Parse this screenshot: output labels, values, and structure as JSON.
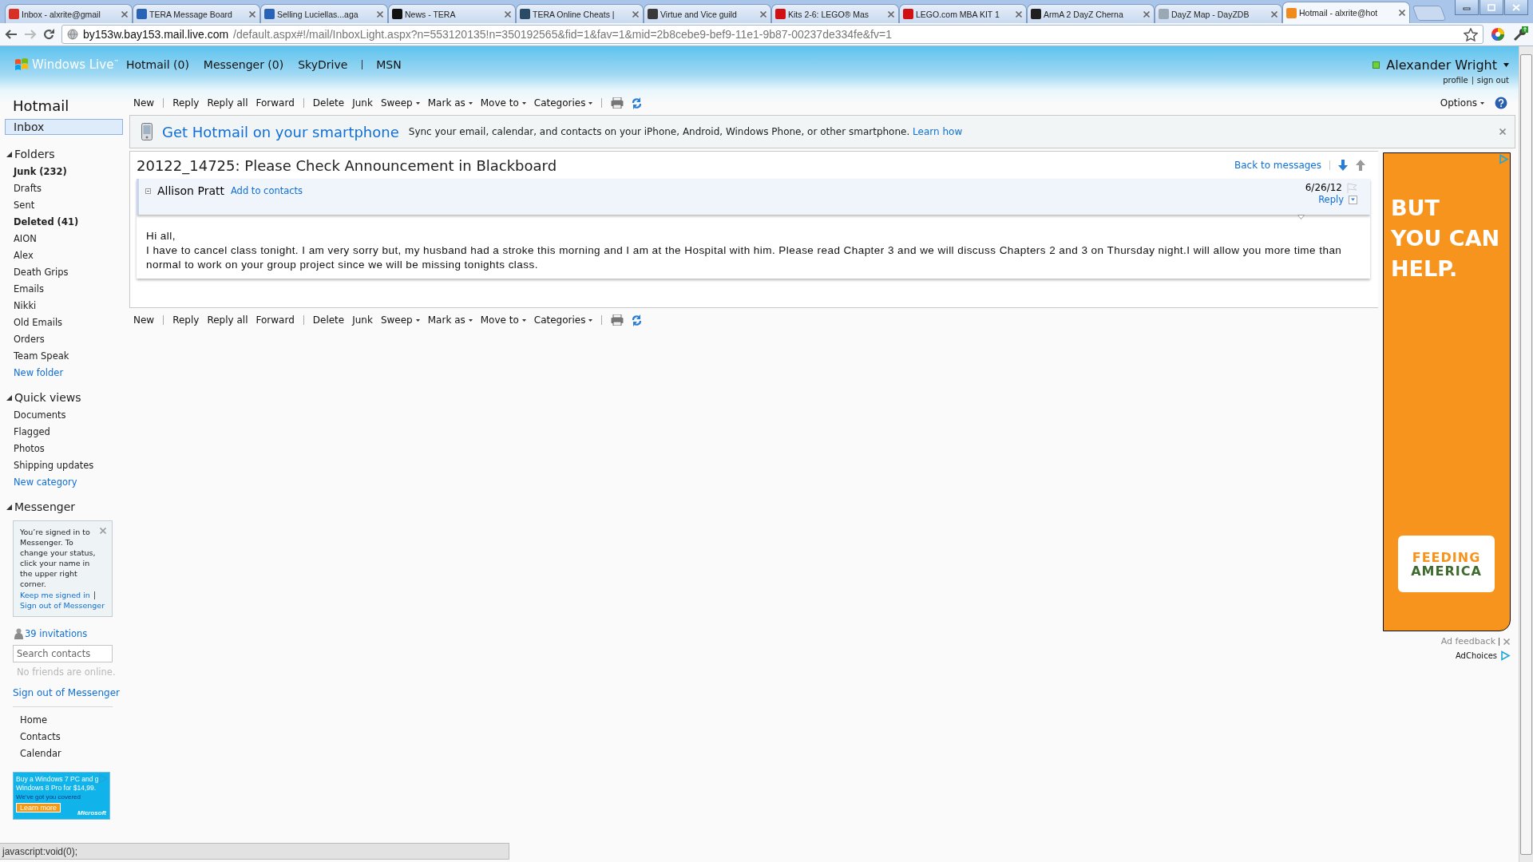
{
  "browser": {
    "tabs": [
      {
        "title": "Inbox - alxrite@gmail",
        "color": "#d93025",
        "selected": false
      },
      {
        "title": "TERA Message Board",
        "color": "#2a62b5",
        "selected": false
      },
      {
        "title": "Selling Luciellas...aga",
        "color": "#2a62b5",
        "selected": false
      },
      {
        "title": "News - TERA",
        "color": "#111111",
        "selected": false
      },
      {
        "title": "TERA Online Cheats |",
        "color": "#2b4a66",
        "selected": false
      },
      {
        "title": "Virtue and Vice guild",
        "color": "#3a3a3a",
        "selected": false
      },
      {
        "title": "Kits 2-6: LEGO® Mas",
        "color": "#d01012",
        "selected": false
      },
      {
        "title": "LEGO.com MBA KIT 1",
        "color": "#d01012",
        "selected": false
      },
      {
        "title": "ArmA 2 DayZ Cherna",
        "color": "#202020",
        "selected": false
      },
      {
        "title": "DayZ Map - DayZDB",
        "color": "#9aa7b4",
        "selected": false
      },
      {
        "title": "Hotmail - alxrite@hot",
        "color": "#f08a1c",
        "selected": true
      }
    ],
    "address": {
      "host": "by153w.bay153.mail.live.com",
      "path": "/default.aspx#!/mail/InboxLight.aspx?n=553120135!n=350192565&fid=1&fav=1&mid=2b8cebe9-bef9-11e1-9b87-00237de334fe&fv=1"
    }
  },
  "header": {
    "brand": "Windows Live$^{™}$",
    "nav": [
      {
        "label": "Hotmail (0)",
        "divider_before": false
      },
      {
        "label": "Messenger (0)",
        "divider_before": false
      },
      {
        "label": "SkyDrive",
        "divider_before": false
      },
      {
        "label": "MSN",
        "divider_before": true
      }
    ],
    "user": {
      "name": "Alexander Wright",
      "online": true,
      "links": [
        "profile",
        "sign out"
      ]
    }
  },
  "sidebar": {
    "title": "Hotmail",
    "inbox": {
      "label": "Inbox",
      "selected": true
    },
    "sections": [
      {
        "title": "Folders",
        "expanded": true,
        "items": [
          {
            "label": "Junk (232)",
            "kind": "folder",
            "unread": true
          },
          {
            "label": "Drafts",
            "kind": "folder",
            "unread": false
          },
          {
            "label": "Sent",
            "kind": "folder",
            "unread": false
          },
          {
            "label": "Deleted (41)",
            "kind": "folder",
            "unread": true
          },
          {
            "label": "AION",
            "kind": "folder",
            "unread": false
          },
          {
            "label": "Alex",
            "kind": "folder",
            "unread": false
          },
          {
            "label": "Death Grips",
            "kind": "folder",
            "unread": false
          },
          {
            "label": "Emails",
            "kind": "folder",
            "unread": false
          },
          {
            "label": "Nikki",
            "kind": "folder",
            "unread": false
          },
          {
            "label": "Old Emails",
            "kind": "folder",
            "unread": false
          },
          {
            "label": "Orders",
            "kind": "folder",
            "unread": false
          },
          {
            "label": "Team Speak",
            "kind": "folder",
            "unread": false
          },
          {
            "label": "New folder",
            "kind": "link",
            "unread": false
          }
        ]
      },
      {
        "title": "Quick views",
        "expanded": true,
        "items": [
          {
            "label": "Documents",
            "kind": "folder",
            "unread": false
          },
          {
            "label": "Flagged",
            "kind": "folder",
            "unread": false
          },
          {
            "label": "Photos",
            "kind": "folder",
            "unread": false
          },
          {
            "label": "Shipping updates",
            "kind": "folder",
            "unread": false
          },
          {
            "label": "New category",
            "kind": "link",
            "unread": false
          }
        ]
      }
    ],
    "messenger": {
      "title": "Messenger",
      "expanded": true,
      "notice": {
        "text": "You’re signed in to Messenger. To change your status, click your name in the upper right corner.",
        "links": [
          "Keep me signed in",
          "Sign out of Messenger"
        ]
      },
      "invitations": "39 invitations",
      "search": {
        "placeholder": "Search contacts"
      },
      "empty": "No friends are online.",
      "sign_out": "Sign out of Messenger"
    },
    "links": [
      "Home",
      "Contacts",
      "Calendar"
    ],
    "ad": {
      "lines": [
        "Buy a Windows 7 PC and g",
        "Windows 8 Pro for $14,99."
      ],
      "tagline": "We've got you covered",
      "button": "Learn more",
      "brand": "Microsoft"
    }
  },
  "toolbars": [
    {
      "items": [
        {
          "label": "New",
          "kind": "text",
          "dropdown": false,
          "divider_before": false
        },
        {
          "label": "Reply",
          "kind": "text",
          "dropdown": false,
          "divider_before": true
        },
        {
          "label": "Reply all",
          "kind": "text",
          "dropdown": false,
          "divider_before": false
        },
        {
          "label": "Forward",
          "kind": "text",
          "dropdown": false,
          "divider_before": false
        },
        {
          "label": "Delete",
          "kind": "text",
          "dropdown": false,
          "divider_before": true
        },
        {
          "label": "Junk",
          "kind": "text",
          "dropdown": false,
          "divider_before": false
        },
        {
          "label": "Sweep",
          "kind": "text",
          "dropdown": true,
          "divider_before": false
        },
        {
          "label": "Mark as",
          "kind": "text",
          "dropdown": true,
          "divider_before": false
        },
        {
          "label": "Move to",
          "kind": "text",
          "dropdown": true,
          "divider_before": false
        },
        {
          "label": "Categories",
          "kind": "text",
          "dropdown": true,
          "divider_before": false
        },
        {
          "kind": "print",
          "dropdown": false,
          "divider_before": true
        },
        {
          "kind": "refresh",
          "dropdown": false,
          "divider_before": false
        }
      ],
      "options": {
        "label": "Options",
        "dropdown": true
      }
    },
    {
      "items": [
        {
          "label": "New",
          "kind": "text",
          "dropdown": false,
          "divider_before": false
        },
        {
          "label": "Reply",
          "kind": "text",
          "dropdown": false,
          "divider_before": true
        },
        {
          "label": "Reply all",
          "kind": "text",
          "dropdown": false,
          "divider_before": false
        },
        {
          "label": "Forward",
          "kind": "text",
          "dropdown": false,
          "divider_before": false
        },
        {
          "label": "Delete",
          "kind": "text",
          "dropdown": false,
          "divider_before": true
        },
        {
          "label": "Junk",
          "kind": "text",
          "dropdown": false,
          "divider_before": false
        },
        {
          "label": "Sweep",
          "kind": "text",
          "dropdown": true,
          "divider_before": false
        },
        {
          "label": "Mark as",
          "kind": "text",
          "dropdown": true,
          "divider_before": false
        },
        {
          "label": "Move to",
          "kind": "text",
          "dropdown": true,
          "divider_before": false
        },
        {
          "label": "Categories",
          "kind": "text",
          "dropdown": true,
          "divider_before": false
        },
        {
          "kind": "print",
          "dropdown": false,
          "divider_before": true
        },
        {
          "kind": "refresh",
          "dropdown": false,
          "divider_before": false
        }
      ]
    }
  ],
  "promo": {
    "title": "Get Hotmail on your smartphone",
    "text": "Sync your email, calendar, and contacts on your iPhone, Android, Windows Phone, or other smartphone.",
    "link": "Learn how"
  },
  "message": {
    "subject": "20122_14725: Please Check Announcement in Blackboard",
    "back_link": "Back to messages",
    "sender": "Allison Pratt",
    "add_contact": "Add to contacts",
    "date": "6/26/12",
    "reply": "Reply",
    "greeting": "Hi all,",
    "body": "I have to cancel class tonight. I am very sorry but, my husband had a stroke this morning and I am at the Hospital with him. Please read Chapter 3 and we will discuss Chapters 2 and 3 on Thursday night.I will allow you more time than normal to work on your group project since we will be missing tonights class."
  },
  "ad": {
    "headline": [
      "BUT",
      "YOU CAN",
      "HELP."
    ],
    "logo": [
      "FEEDING",
      "AMERICA"
    ],
    "feedback": "Ad feedback",
    "adchoices": "AdChoices"
  },
  "status_bar": "javascript:void(0);"
}
